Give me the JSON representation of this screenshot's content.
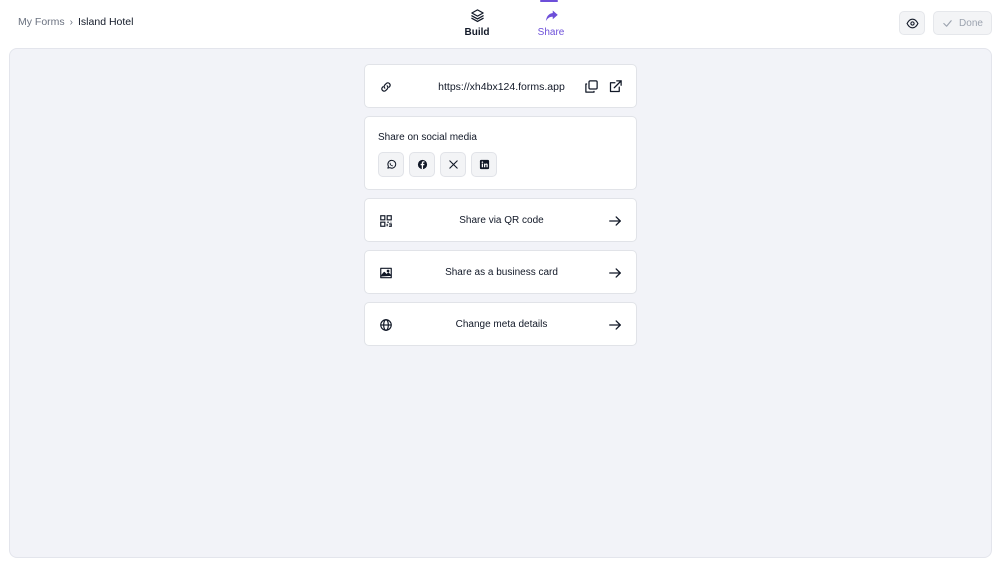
{
  "breadcrumb": {
    "parent": "My Forms",
    "separator": "›",
    "current": "Island Hotel"
  },
  "tabs": [
    {
      "label": "Build",
      "icon": "layers-icon",
      "active": false
    },
    {
      "label": "Share",
      "icon": "share-arrow-icon",
      "active": true
    }
  ],
  "header_actions": {
    "preview_icon": "eye-icon",
    "done_label": "Done",
    "done_icon": "check-icon"
  },
  "share": {
    "url": "https://xh4bx124.forms.app",
    "social_title": "Share on social media",
    "social_networks": [
      "whatsapp",
      "facebook",
      "x",
      "linkedin"
    ],
    "qr_label": "Share via QR code",
    "business_card_label": "Share as a business card",
    "meta_label": "Change meta details"
  },
  "colors": {
    "accent": "#6d4fd9",
    "canvas_bg": "#f2f3f8",
    "card_border": "#e1e3e8"
  }
}
